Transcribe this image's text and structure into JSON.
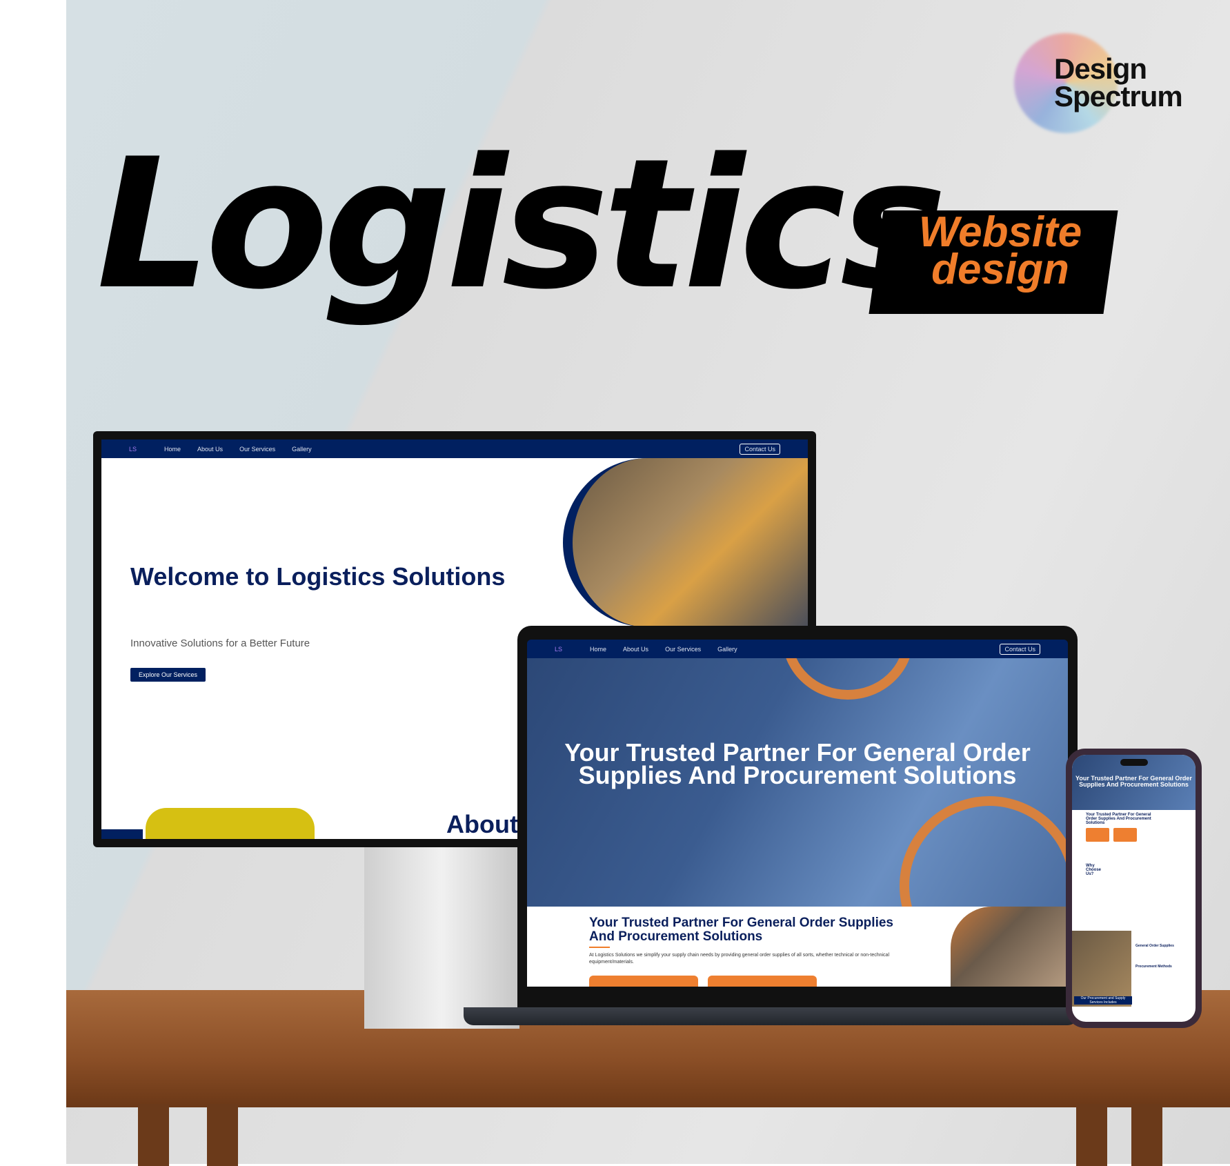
{
  "brand": {
    "logo_line1": "Design",
    "logo_line2": "Spectrum"
  },
  "headline": {
    "title": "Logistics",
    "badge_line1": "Website",
    "badge_line2": "design"
  },
  "colors": {
    "navy": "#012060",
    "orange": "#f07d2a"
  },
  "nav": {
    "logo": "LS",
    "items": [
      "Home",
      "About Us",
      "Our Services",
      "Gallery"
    ],
    "cta": "Contact Us"
  },
  "desktop": {
    "heading": "Welcome to Logistics Solutions",
    "subtitle": "Innovative Solutions for a Better Future",
    "button": "Explore Our Services",
    "about": "About"
  },
  "laptop": {
    "hero_title": "Your Trusted Partner For General Order Supplies And Procurement Solutions",
    "section_title": "Your Trusted Partner For General Order Supplies And Procurement Solutions",
    "paragraph": "At Logistics Solutions we simplify your supply chain needs by providing general order supplies of all sorts, whether technical or non-technical equipment/materials."
  },
  "phone": {
    "hero_title": "Your Trusted Partner For General Order Supplies And Procurement Solutions",
    "section_title": "Your Trusted Partner For General Order Supplies And Procurement Solutions",
    "why": "Why Choose Us?",
    "general": "General Order Supplies",
    "methods": "Procurement Methods",
    "band": "Our Procurement and Supply Services Includes"
  }
}
